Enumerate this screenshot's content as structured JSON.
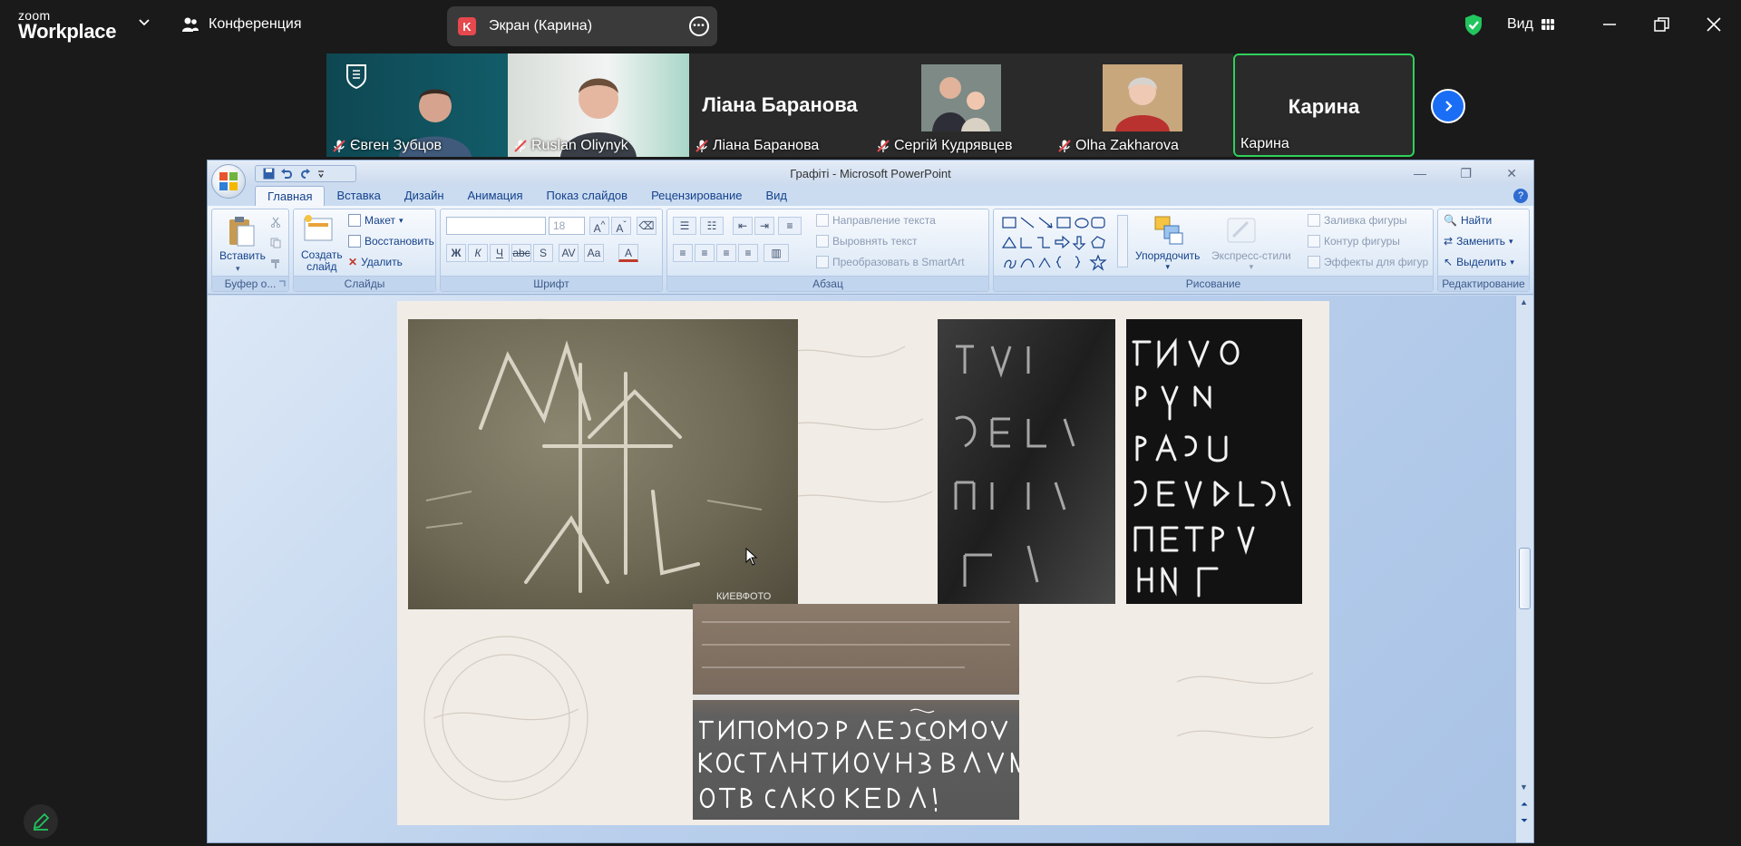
{
  "zoom": {
    "logo_line1": "zoom",
    "logo_line2": "Workplace",
    "meeting_label": "Конференция",
    "share_initial": "K",
    "share_label": "Экран (Карина)",
    "view_label": "Вид",
    "accent": "#1a6ef5",
    "active_border": "#2ed15b"
  },
  "participants": [
    {
      "name": "Євген Зубцов",
      "muted": true,
      "video": true
    },
    {
      "name": "Ruslan Oliynyk",
      "muted": true,
      "video": true
    },
    {
      "name": "Ліана Баранова",
      "muted": true,
      "video": false,
      "big_name": "Ліана Баранова"
    },
    {
      "name": "Сергій Кудрявцев",
      "muted": true,
      "video": true
    },
    {
      "name": "Olha Zakharova",
      "muted": true,
      "video": true
    },
    {
      "name": "Карина",
      "muted": false,
      "video": false,
      "big_name": "Карина",
      "active": true
    }
  ],
  "ppt": {
    "window_title": "Графіті - Microsoft PowerPoint",
    "tabs": [
      "Главная",
      "Вставка",
      "Дизайн",
      "Анимация",
      "Показ слайдов",
      "Рецензирование",
      "Вид"
    ],
    "selected_tab": "Главная",
    "groups": {
      "clipboard": {
        "name": "Буфер о...",
        "paste": "Вставить"
      },
      "slides": {
        "name": "Слайды",
        "new_slide_1": "Создать",
        "new_slide_2": "слайд",
        "layout": "Макет",
        "reset": "Восстановить",
        "delete": "Удалить"
      },
      "font": {
        "name": "Шрифт",
        "font_size": "18"
      },
      "paragraph": {
        "name": "Абзац",
        "text_direction": "Направление текста",
        "align_text": "Выровнять текст",
        "smartart": "Преобразовать в SmartArt"
      },
      "drawing": {
        "name": "Рисование",
        "arrange": "Упорядочить",
        "quick_styles": "Экспресс-стили",
        "shape_fill": "Заливка фигуры",
        "shape_outline": "Контур фигуры",
        "shape_effects": "Эффекты для фигур"
      },
      "editing": {
        "name": "Редактирование",
        "find": "Найти",
        "replace": "Заменить",
        "select": "Выделить"
      }
    },
    "slide_watermark": "КИЕВФОТО"
  }
}
